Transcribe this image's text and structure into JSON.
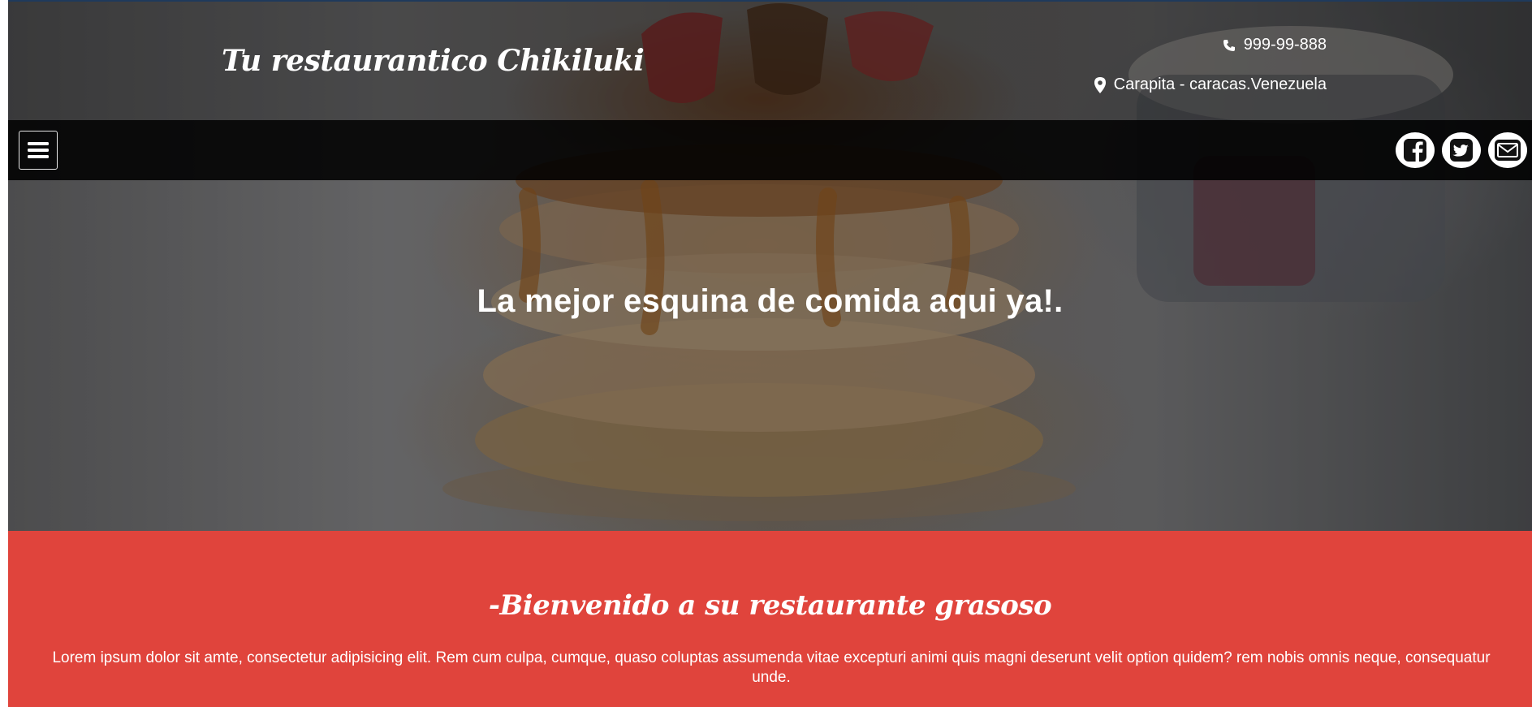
{
  "header": {
    "brand": "Tu restaurantico Chikiluki",
    "phone": "999-99-888",
    "location": "Carapita - caracas.Venezuela"
  },
  "nav": {
    "menu_icon": "hamburger-menu-icon",
    "social": [
      {
        "name": "facebook",
        "icon": "facebook-icon"
      },
      {
        "name": "twitter",
        "icon": "twitter-icon"
      },
      {
        "name": "email",
        "icon": "envelope-icon"
      }
    ]
  },
  "hero": {
    "title": "La mejor esquina de comida aqui ya!."
  },
  "welcome": {
    "title": "-Bienvenido a su restaurante grasoso",
    "text": "Lorem ipsum dolor sit amte, consectetur adipisicing elit. Rem cum culpa, cumque, quaso coluptas assumenda vitae excepturi animi quis magni deserunt velit option quidem? rem nobis omnis neque, consequatur unde."
  },
  "colors": {
    "welcome_background": "#e0443c",
    "navbar_background": "#000000",
    "top_strip": "#1f3a5c"
  }
}
